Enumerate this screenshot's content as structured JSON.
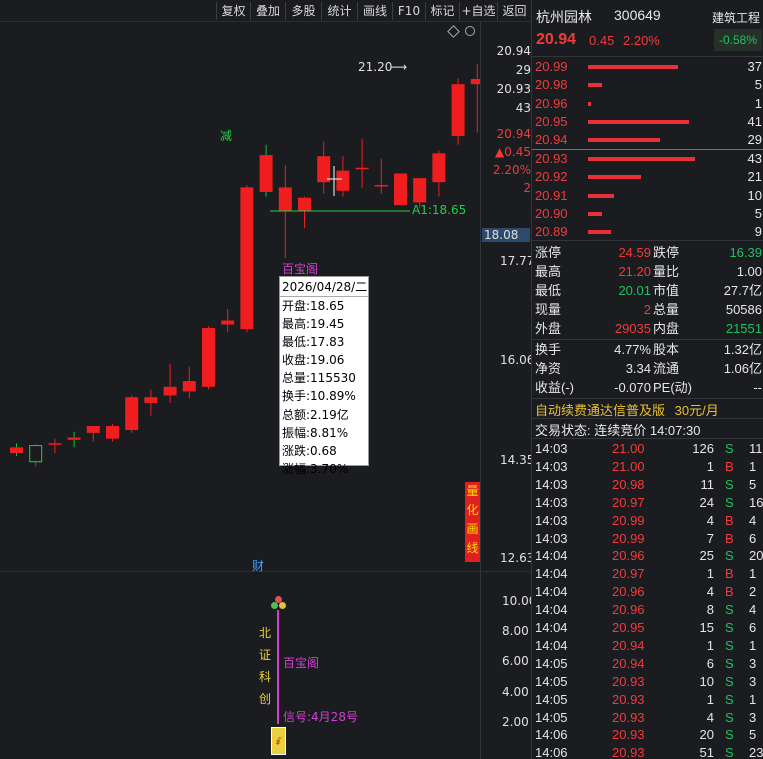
{
  "toolbar": {
    "buttons": [
      "复权",
      "叠加",
      "多股",
      "统计",
      "画线",
      "F10",
      "标记",
      "+自选",
      "返回"
    ]
  },
  "kline": {
    "price_axis": [
      "20.94",
      "29",
      "20.93",
      "43",
      "20.94",
      "▲0.45",
      "2.20%",
      "2",
      "18.08",
      "17.77",
      "16.06",
      "14.35",
      "12.63"
    ],
    "high_label": "21.20",
    "reduce_label": "减",
    "line_label": "A1:18.65",
    "baibao_label": "百宝阁",
    "cai_label": "财",
    "side_tag": [
      "量",
      "化",
      "画",
      "线"
    ],
    "candles": [
      {
        "o": 14.55,
        "h": 14.62,
        "l": 14.4,
        "c": 14.45
      },
      {
        "o": 14.3,
        "h": 14.6,
        "l": 14.22,
        "c": 14.58
      },
      {
        "o": 14.6,
        "h": 14.7,
        "l": 14.45,
        "c": 14.62
      },
      {
        "o": 14.72,
        "h": 14.82,
        "l": 14.55,
        "c": 14.68
      },
      {
        "o": 14.8,
        "h": 14.92,
        "l": 14.65,
        "c": 14.92
      },
      {
        "o": 14.7,
        "h": 14.95,
        "l": 14.65,
        "c": 14.92
      },
      {
        "o": 14.85,
        "h": 15.45,
        "l": 14.8,
        "c": 15.42
      },
      {
        "o": 15.32,
        "h": 15.55,
        "l": 15.1,
        "c": 15.42
      },
      {
        "o": 15.45,
        "h": 16.0,
        "l": 15.32,
        "c": 15.6
      },
      {
        "o": 15.52,
        "h": 15.95,
        "l": 15.4,
        "c": 15.7
      },
      {
        "o": 15.6,
        "h": 16.65,
        "l": 15.55,
        "c": 16.62
      },
      {
        "o": 16.68,
        "h": 16.95,
        "l": 16.55,
        "c": 16.75
      },
      {
        "o": 16.6,
        "h": 19.1,
        "l": 16.55,
        "c": 19.06
      },
      {
        "o": 19.62,
        "h": 19.8,
        "l": 18.9,
        "c": 18.98
      },
      {
        "o": 18.65,
        "h": 19.45,
        "l": 17.83,
        "c": 19.06
      },
      {
        "o": 18.65,
        "h": 18.9,
        "l": 18.35,
        "c": 18.88
      },
      {
        "o": 19.15,
        "h": 19.85,
        "l": 18.95,
        "c": 19.6
      },
      {
        "o": 19.0,
        "h": 19.6,
        "l": 18.9,
        "c": 19.35
      },
      {
        "o": 19.38,
        "h": 19.9,
        "l": 19.05,
        "c": 19.4
      },
      {
        "o": 19.1,
        "h": 19.55,
        "l": 18.95,
        "c": 19.1
      },
      {
        "o": 19.3,
        "h": 19.3,
        "l": 18.75,
        "c": 18.75
      },
      {
        "o": 18.8,
        "h": 19.1,
        "l": 18.7,
        "c": 19.22
      },
      {
        "o": 19.15,
        "h": 19.7,
        "l": 18.9,
        "c": 19.65
      },
      {
        "o": 19.95,
        "h": 20.95,
        "l": 19.8,
        "c": 20.85
      },
      {
        "o": 20.85,
        "h": 21.2,
        "l": 20.01,
        "c": 20.94
      }
    ],
    "ylim": [
      12.63,
      21.2
    ]
  },
  "tooltip": {
    "date": "2026/04/28/二",
    "rows": [
      "开盘:18.65",
      "最高:19.45",
      "最低:17.83",
      "收盘:19.06",
      "总量:115530",
      "换手:10.89%",
      "总额:2.19亿",
      "振幅:8.81%",
      "涨跌:0.68",
      "涨幅:3.70%"
    ]
  },
  "indicator": {
    "axis": [
      "10.00",
      "8.00",
      "6.00",
      "4.00",
      "2.00"
    ],
    "vertical_text": [
      "北",
      "证",
      "科",
      "创"
    ],
    "baibao_label": "百宝阁",
    "signal_label": "信号:4月28号"
  },
  "quote": {
    "name": "杭州园林",
    "code": "300649",
    "sector": "建筑工程",
    "sector_change": "-0.58%",
    "price": "20.94",
    "change": "0.45",
    "change_pct": "2.20%",
    "asks": [
      {
        "price": "20.99",
        "vol": "37",
        "bar": 0.6
      },
      {
        "price": "20.98",
        "vol": "5",
        "bar": 0.09
      },
      {
        "price": "20.96",
        "vol": "1",
        "bar": 0.02
      },
      {
        "price": "20.95",
        "vol": "41",
        "bar": 0.67
      },
      {
        "price": "20.94",
        "vol": "29",
        "bar": 0.48
      }
    ],
    "bids": [
      {
        "price": "20.93",
        "vol": "43",
        "bar": 0.71
      },
      {
        "price": "20.92",
        "vol": "21",
        "bar": 0.35
      },
      {
        "price": "20.91",
        "vol": "10",
        "bar": 0.17
      },
      {
        "price": "20.90",
        "vol": "5",
        "bar": 0.09
      },
      {
        "price": "20.89",
        "vol": "9",
        "bar": 0.15
      }
    ],
    "stats": [
      {
        "l1": "涨停",
        "v1": "24.59",
        "c1": "red",
        "l2": "跌停",
        "v2": "16.39",
        "c2": "green"
      },
      {
        "l1": "最高",
        "v1": "21.20",
        "c1": "red",
        "l2": "量比",
        "v2": "1.00",
        "c2": "white"
      },
      {
        "l1": "最低",
        "v1": "20.01",
        "c1": "green",
        "l2": "市值",
        "v2": "27.7亿",
        "c2": "white"
      },
      {
        "l1": "现量",
        "v1": "2",
        "c1": "red",
        "l2": "总量",
        "v2": "50586",
        "c2": "white"
      },
      {
        "l1": "外盘",
        "v1": "29035",
        "c1": "red",
        "l2": "内盘",
        "v2": "21551",
        "c2": "green"
      }
    ],
    "stats2": [
      {
        "l1": "换手",
        "v1": "4.77%",
        "l2": "股本",
        "v2": "1.32亿"
      },
      {
        "l1": "净资",
        "v1": "3.34",
        "l2": "流通",
        "v2": "1.06亿"
      },
      {
        "l1": "收益(-)",
        "v1": "-0.070",
        "l2": "PE(动)",
        "v2": "--"
      }
    ],
    "promo": "自动续费通达信普及版",
    "promo_price": "30元/月",
    "status": "交易状态: 连续竞价 14:07:30",
    "ticks": [
      {
        "t": "14:03",
        "p": "21.00",
        "v": "126",
        "s": "S",
        "n": "11"
      },
      {
        "t": "14:03",
        "p": "21.00",
        "v": "1",
        "s": "B",
        "n": "1"
      },
      {
        "t": "14:03",
        "p": "20.98",
        "v": "11",
        "s": "S",
        "n": "5"
      },
      {
        "t": "14:03",
        "p": "20.97",
        "v": "24",
        "s": "S",
        "n": "16"
      },
      {
        "t": "14:03",
        "p": "20.99",
        "v": "4",
        "s": "B",
        "n": "4"
      },
      {
        "t": "14:03",
        "p": "20.99",
        "v": "7",
        "s": "B",
        "n": "6"
      },
      {
        "t": "14:04",
        "p": "20.96",
        "v": "25",
        "s": "S",
        "n": "20"
      },
      {
        "t": "14:04",
        "p": "20.97",
        "v": "1",
        "s": "B",
        "n": "1"
      },
      {
        "t": "14:04",
        "p": "20.96",
        "v": "4",
        "s": "B",
        "n": "2"
      },
      {
        "t": "14:04",
        "p": "20.96",
        "v": "8",
        "s": "S",
        "n": "4"
      },
      {
        "t": "14:04",
        "p": "20.95",
        "v": "15",
        "s": "S",
        "n": "6"
      },
      {
        "t": "14:04",
        "p": "20.94",
        "v": "1",
        "s": "S",
        "n": "1"
      },
      {
        "t": "14:05",
        "p": "20.94",
        "v": "6",
        "s": "S",
        "n": "3"
      },
      {
        "t": "14:05",
        "p": "20.93",
        "v": "10",
        "s": "S",
        "n": "3"
      },
      {
        "t": "14:05",
        "p": "20.93",
        "v": "1",
        "s": "S",
        "n": "1"
      },
      {
        "t": "14:05",
        "p": "20.93",
        "v": "4",
        "s": "S",
        "n": "3"
      },
      {
        "t": "14:06",
        "p": "20.93",
        "v": "20",
        "s": "S",
        "n": "5"
      },
      {
        "t": "14:06",
        "p": "20.93",
        "v": "51",
        "s": "S",
        "n": "23"
      }
    ]
  }
}
